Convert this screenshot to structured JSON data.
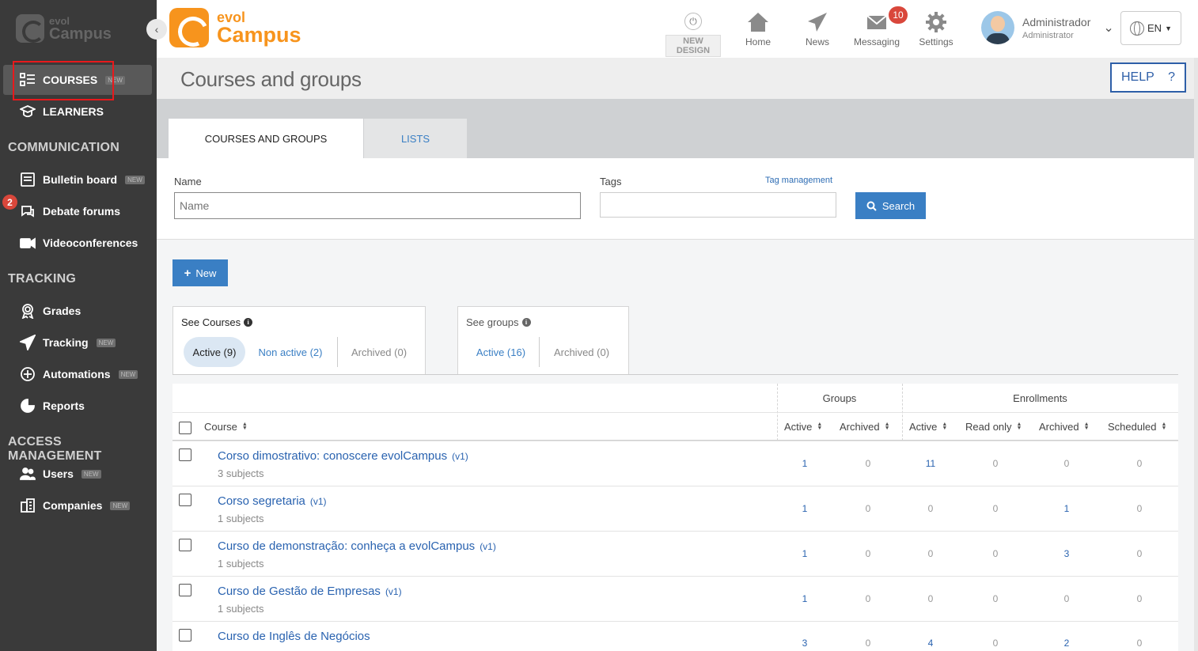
{
  "sidebar": {
    "logo": {
      "line1": "evol",
      "line2": "Campus"
    },
    "collapse_icon": "chevron-left-icon",
    "new_badge": "NEW",
    "items": [
      {
        "label": "COURSES",
        "icon": "list-icon",
        "new": true
      },
      {
        "label": "LEARNERS",
        "icon": "graduation-cap-icon",
        "new": false
      }
    ],
    "sections": [
      {
        "title": "COMMUNICATION",
        "items": [
          {
            "label": "Bulletin board",
            "icon": "bulletin-icon",
            "new": true
          },
          {
            "label": "Debate forums",
            "icon": "forum-icon",
            "new": false,
            "notification": "2"
          },
          {
            "label": "Videoconferences",
            "icon": "video-icon",
            "new": false
          }
        ]
      },
      {
        "title": "TRACKING",
        "items": [
          {
            "label": "Grades",
            "icon": "award-icon",
            "new": false
          },
          {
            "label": "Tracking",
            "icon": "paper-plane-icon",
            "new": true
          },
          {
            "label": "Automations",
            "icon": "plus-circle-icon",
            "new": true
          },
          {
            "label": "Reports",
            "icon": "pie-chart-icon",
            "new": false
          }
        ]
      },
      {
        "title": "ACCESS MANAGEMENT",
        "items": [
          {
            "label": "Users",
            "icon": "users-icon",
            "new": true
          },
          {
            "label": "Companies",
            "icon": "building-icon",
            "new": true
          }
        ]
      }
    ]
  },
  "topbar": {
    "logo": {
      "line1": "evol",
      "line2": "Campus"
    },
    "new_design": {
      "label": "NEW DESIGN",
      "icon": "power-icon"
    },
    "nav": [
      {
        "label": "Home",
        "icon": "home-icon"
      },
      {
        "label": "News",
        "icon": "megaphone-icon"
      },
      {
        "label": "Messaging",
        "icon": "envelope-icon",
        "badge": "10"
      },
      {
        "label": "Settings",
        "icon": "gear-icon"
      }
    ],
    "user": {
      "name": "Administrador",
      "role": "Administrator"
    },
    "language": "EN"
  },
  "page": {
    "title": "Courses and groups",
    "help": {
      "label": "HELP",
      "icon": "?"
    }
  },
  "tabs": [
    {
      "label": "COURSES AND GROUPS",
      "active": true
    },
    {
      "label": "LISTS",
      "active": false
    }
  ],
  "search": {
    "name_label": "Name",
    "name_placeholder": "Name",
    "name_value": "",
    "tags_label": "Tags",
    "tag_management": "Tag management",
    "button": "Search"
  },
  "new_button": "New",
  "see_courses": {
    "title": "See Courses",
    "filters": [
      "Active (9)",
      "Non active (2)",
      "Archived (0)"
    ]
  },
  "see_groups": {
    "title": "See groups",
    "filters": [
      "Active (16)",
      "Archived (0)"
    ]
  },
  "table": {
    "group_headers": {
      "groups": "Groups",
      "enrollments": "Enrollments"
    },
    "columns": [
      "Course",
      "Active",
      "Archived",
      "Active",
      "Read only",
      "Archived",
      "Scheduled"
    ],
    "rows": [
      {
        "name": "Corso dimostrativo: conoscere evolCampus",
        "version": "(v1)",
        "subjects": "3 subjects",
        "values": [
          "1",
          "0",
          "11",
          "0",
          "0",
          "0"
        ]
      },
      {
        "name": "Corso segretaria",
        "version": "(v1)",
        "subjects": "1 subjects",
        "values": [
          "1",
          "0",
          "0",
          "0",
          "1",
          "0"
        ]
      },
      {
        "name": "Curso de demonstração: conheça a evolCampus",
        "version": "(v1)",
        "subjects": "1 subjects",
        "values": [
          "1",
          "0",
          "0",
          "0",
          "3",
          "0"
        ]
      },
      {
        "name": "Curso de Gestão de Empresas",
        "version": "(v1)",
        "subjects": "1 subjects",
        "values": [
          "1",
          "0",
          "0",
          "0",
          "0",
          "0"
        ]
      },
      {
        "name": "Curso de Inglês de Negócios",
        "version": "",
        "subjects": "",
        "values": [
          "3",
          "0",
          "4",
          "0",
          "2",
          "0"
        ]
      }
    ]
  }
}
